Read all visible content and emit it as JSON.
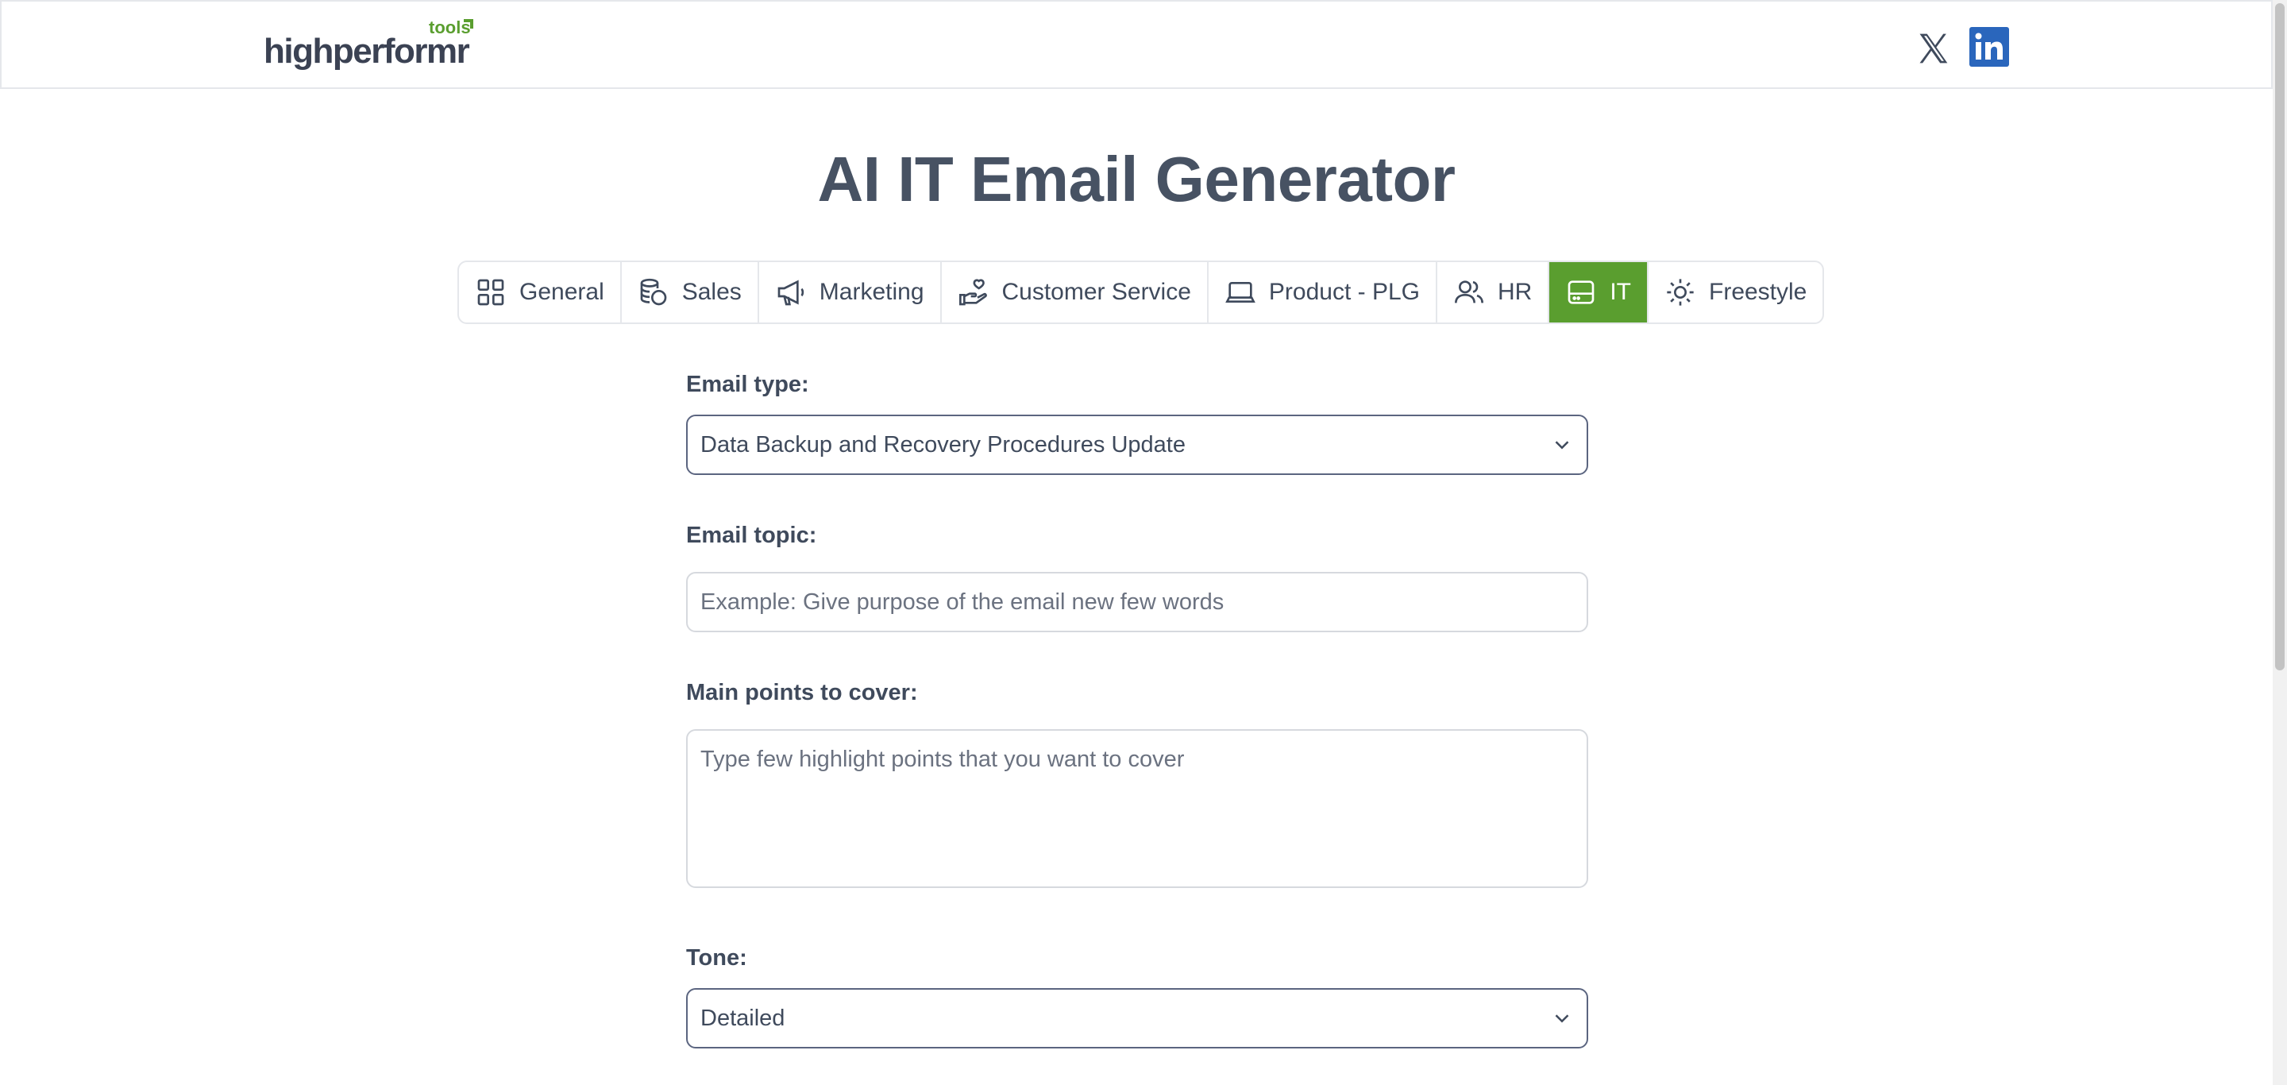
{
  "brand": {
    "logo_text": "highperformr",
    "logo_tag": "tools",
    "accent_color": "#5a9e2f"
  },
  "header": {
    "social": [
      {
        "name": "x-icon"
      },
      {
        "name": "linkedin-icon",
        "color": "#2a66bc"
      }
    ]
  },
  "page": {
    "title": "AI IT Email Generator"
  },
  "tabs": [
    {
      "label": "General",
      "icon": "grid-icon",
      "active": false
    },
    {
      "label": "Sales",
      "icon": "coins-icon",
      "active": false
    },
    {
      "label": "Marketing",
      "icon": "megaphone-icon",
      "active": false
    },
    {
      "label": "Customer Service",
      "icon": "hand-heart-icon",
      "active": false
    },
    {
      "label": "Product - PLG",
      "icon": "laptop-icon",
      "active": false
    },
    {
      "label": "HR",
      "icon": "users-icon",
      "active": false
    },
    {
      "label": "IT",
      "icon": "hard-drive-icon",
      "active": true
    },
    {
      "label": "Freestyle",
      "icon": "sun-icon",
      "active": false
    }
  ],
  "form": {
    "email_type": {
      "label": "Email type:",
      "value": "Data Backup and Recovery Procedures Update"
    },
    "email_topic": {
      "label": "Email topic:",
      "placeholder": "Example: Give purpose of the email new few words"
    },
    "main_points": {
      "label": "Main points to cover:",
      "placeholder": "Type few highlight points that you want to cover"
    },
    "tone": {
      "label": "Tone:",
      "value": "Detailed"
    }
  }
}
